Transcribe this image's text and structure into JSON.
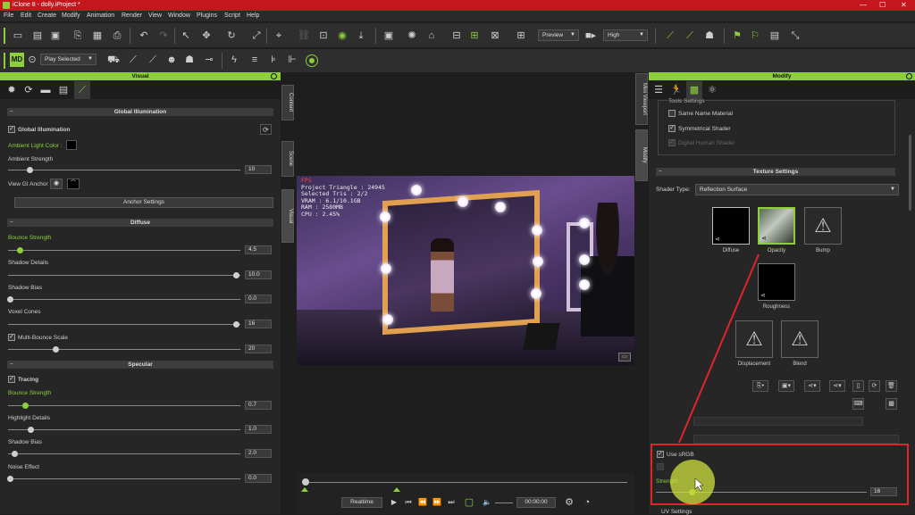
{
  "window": {
    "title": "iClone 8 - dolly.iProject *",
    "minimize": "—",
    "maximize": "☐",
    "close": "✕"
  },
  "menu": [
    "File",
    "Edit",
    "Create",
    "Modify",
    "Animation",
    "Render",
    "View",
    "Window",
    "Plugins",
    "Script",
    "Help"
  ],
  "toolbar": {
    "quality_mode": "Preview",
    "quality_level": "High",
    "play_mode": "Play Selected"
  },
  "visual_panel": {
    "title": "Visual",
    "global_illumination": {
      "section": "Global Illumination",
      "checkbox_label": "Global Illumination",
      "ambient_light_color_label": "Ambient Light Color :",
      "ambient_strength_label": "Ambient Strength",
      "ambient_strength_value": "10",
      "ambient_strength_level": 0.1,
      "view_gi_anchor_label": "View GI Anchor",
      "anchor_settings_button": "Anchor Settings"
    },
    "diffuse": {
      "section": "Diffuse",
      "bounce_strength_label": "Bounce Strength",
      "bounce_strength_value": "4.5",
      "bounce_strength_level": 0.05,
      "shadow_details_label": "Shadow Details",
      "shadow_details_value": "10.0",
      "shadow_details_level": 1.0,
      "shadow_bias_label": "Shadow Bias",
      "shadow_bias_value": "0.0",
      "shadow_bias_level": 0.0,
      "voxel_cones_label": "Voxel Cones",
      "voxel_cones_value": "16",
      "voxel_cones_level": 1.0,
      "multi_bounce_label": "Multi-Bounce Scale",
      "multi_bounce_value": "20",
      "multi_bounce_level": 0.2
    },
    "specular": {
      "section": "Specular",
      "tracing_label": "Tracing",
      "bounce_strength_label": "Bounce Strength",
      "bounce_strength_value": "0.7",
      "bounce_strength_level": 0.07,
      "highlight_details_label": "Highlight Details",
      "highlight_details_value": "1.0",
      "highlight_details_level": 0.1,
      "shadow_bias_label": "Shadow Bias",
      "shadow_bias_value": "2.0",
      "shadow_bias_level": 0.03,
      "noise_effect_label": "Noise Effect",
      "noise_effect_value": "0.0",
      "noise_effect_level": 0.0
    }
  },
  "side_tabs": [
    "Content",
    "Scene",
    "Visual"
  ],
  "right_side_tabs": [
    "Mini Viewport",
    "Modify"
  ],
  "viewport": {
    "stats": [
      "FPS",
      "Project Triangle : 24945",
      "Selected Tris : 2/2",
      "VRAM : 6.1/10.1GB",
      "RAM : 2580MB",
      "CPU : 2.45%"
    ]
  },
  "playback": {
    "mode": "Realtime",
    "time": "00:00:00"
  },
  "modify_panel": {
    "title": "Modify",
    "tools_settings": "Tools Settings",
    "same_name_material": "Same Name Material",
    "symmetrical_shader": "Symmetrical Shader",
    "digital_human_shader": "Digital Human Shader",
    "texture_settings": "Texture Settings",
    "shader_type_label": "Shader Type:",
    "shader_type_value": "Reflection Surface",
    "slots": {
      "diffuse": "Diffuse",
      "opacity": "Opacity",
      "bump": "Bump",
      "roughness": "Roughness",
      "displacement": "Displacement",
      "blend": "Blend"
    },
    "use_srgb": "Use sRGB",
    "strength_label": "Strength",
    "strength_value": "16",
    "strength_level": 0.16,
    "uv_settings": "UV Settings"
  },
  "colors": {
    "accent": "#8ccf3a",
    "titlebar": "#c4161c",
    "highlight_box": "#e0242a",
    "cursor_halo": "#cde03c"
  }
}
